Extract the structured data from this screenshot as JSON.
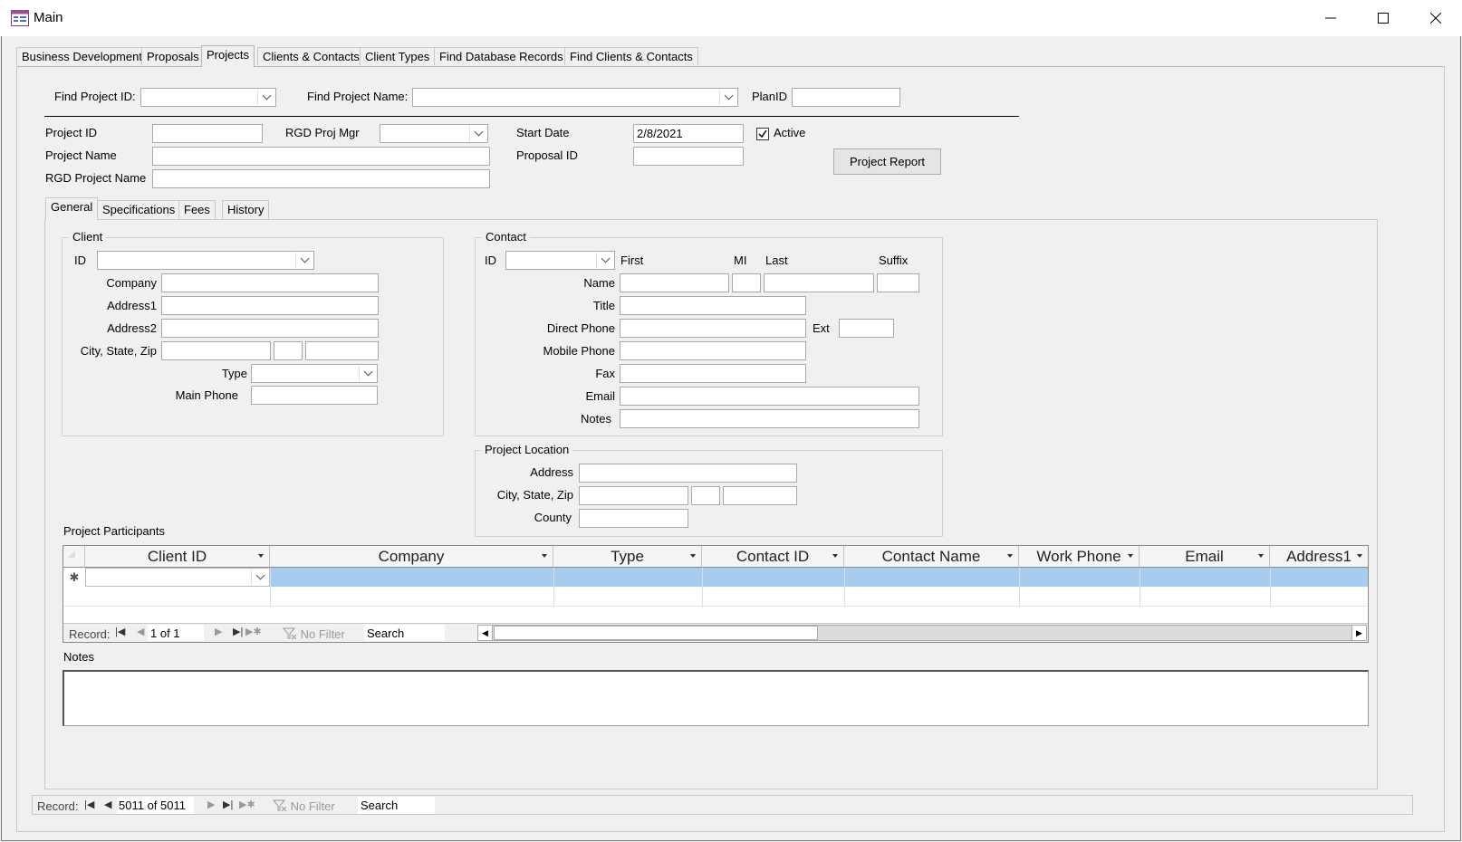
{
  "window": {
    "title": "Main",
    "minimize": "—",
    "maximize": "☐",
    "close": "✕"
  },
  "main_tabs": [
    "Business Development",
    "Proposals",
    "Projects",
    "Clients & Contacts",
    "Client Types",
    "Find Database Records",
    "Find Clients & Contacts"
  ],
  "find": {
    "project_id_label": "Find Project ID:",
    "project_name_label": "Find Project Name:",
    "planid_label": "PlanID"
  },
  "project": {
    "project_id_label": "Project ID",
    "rgd_proj_mgr_label": "RGD Proj Mgr",
    "start_date_label": "Start Date",
    "start_date_value": "2/8/2021",
    "active_label": "Active",
    "project_name_label": "Project Name",
    "proposal_id_label": "Proposal ID",
    "rgd_project_name_label": "RGD Project Name",
    "report_button": "Project Report"
  },
  "sub_tabs": [
    "General",
    "Specifications",
    "Fees",
    "History"
  ],
  "client": {
    "group_title": "Client",
    "id_label": "ID",
    "company_label": "Company",
    "address1_label": "Address1",
    "address2_label": "Address2",
    "city_state_zip_label": "City, State, Zip",
    "type_label": "Type",
    "main_phone_label": "Main Phone"
  },
  "contact": {
    "group_title": "Contact",
    "id_label": "ID",
    "first_label": "First",
    "mi_label": "MI",
    "last_label": "Last",
    "suffix_label": "Suffix",
    "name_label": "Name",
    "title_label": "Title",
    "direct_phone_label": "Direct Phone",
    "ext_label": "Ext",
    "mobile_phone_label": "Mobile Phone",
    "fax_label": "Fax",
    "email_label": "Email",
    "notes_label": "Notes"
  },
  "location": {
    "group_title": "Project Location",
    "address_label": "Address",
    "city_state_zip_label": "City, State, Zip",
    "county_label": "County"
  },
  "participants": {
    "title": "Project Participants",
    "columns": [
      "Client ID",
      "Company",
      "Type",
      "Contact ID",
      "Contact Name",
      "Work Phone",
      "Email",
      "Address1"
    ],
    "new_row_marker": "✱",
    "nav": {
      "record_label": "Record:",
      "position": "1 of 1",
      "filter": "No Filter",
      "search": "Search"
    }
  },
  "notes_label": "Notes",
  "bottom_nav": {
    "record_label": "Record:",
    "position": "5011 of 5011",
    "filter": "No Filter",
    "search": "Search"
  },
  "colors": {
    "selected_row": "#a6cdf0",
    "background": "#f0f0f0"
  }
}
